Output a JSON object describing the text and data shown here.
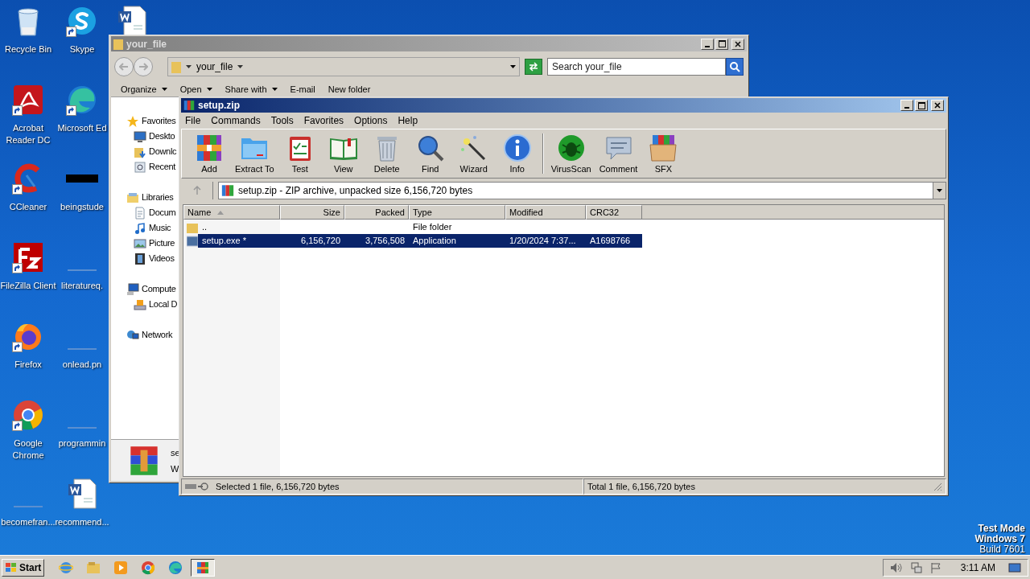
{
  "desktop": {
    "icons": [
      {
        "kind": "recycle",
        "label": "Recycle Bin",
        "shortcut": false
      },
      {
        "kind": "acrobat",
        "label": "Acrobat Reader DC",
        "shortcut": true
      },
      {
        "kind": "ccleaner",
        "label": "CCleaner",
        "shortcut": true
      },
      {
        "kind": "filezilla",
        "label": "FileZilla Client",
        "shortcut": true
      },
      {
        "kind": "firefox",
        "label": "Firefox",
        "shortcut": true
      },
      {
        "kind": "chrome",
        "label": "Google Chrome",
        "shortcut": true
      },
      {
        "kind": "line",
        "label": "becomefran...",
        "shortcut": false
      },
      {
        "kind": "skype",
        "label": "Skype",
        "shortcut": true
      },
      {
        "kind": "edge",
        "label": "Microsoft Ed",
        "shortcut": true
      },
      {
        "kind": "blackbox",
        "label": "beingstude",
        "shortcut": false
      },
      {
        "kind": "line",
        "label": "literatureq.",
        "shortcut": false
      },
      {
        "kind": "line",
        "label": "onlead.pn",
        "shortcut": false
      },
      {
        "kind": "line",
        "label": "programmin",
        "shortcut": false
      },
      {
        "kind": "word",
        "label": "recommend...",
        "shortcut": false
      },
      {
        "kind": "word",
        "shortcut": false
      }
    ],
    "os_notice": [
      {
        "text": "Test Mode",
        "bold": true
      },
      {
        "text": "Windows 7",
        "bold": true
      },
      {
        "text": "Build 7601",
        "bold": false
      }
    ]
  },
  "explorer": {
    "title": "your_file",
    "path": "your_file",
    "search": {
      "placeholder": "Search your_file"
    },
    "toolbar": [
      {
        "label": "Organize",
        "menu": true
      },
      {
        "label": "Open",
        "menu": true
      },
      {
        "label": "Share with",
        "menu": true
      },
      {
        "label": "E-mail",
        "menu": false
      },
      {
        "label": "New folder",
        "menu": false
      }
    ],
    "nav": [
      {
        "kind": "favorites",
        "label": "Favorites",
        "children": [
          {
            "kind": "desktop",
            "label": "Deskto"
          },
          {
            "kind": "downloads",
            "label": "Downlc"
          },
          {
            "kind": "recent",
            "label": "Recent"
          }
        ]
      },
      {
        "kind": "libraries",
        "label": "Libraries",
        "children": [
          {
            "kind": "documents",
            "label": "Docum"
          },
          {
            "kind": "music",
            "label": "Music"
          },
          {
            "kind": "pictures",
            "label": "Picture"
          },
          {
            "kind": "videos",
            "label": "Videos"
          }
        ]
      },
      {
        "kind": "computer",
        "label": "Compute",
        "children": [
          {
            "kind": "drive",
            "label": "Local D"
          }
        ]
      },
      {
        "kind": "network",
        "label": "Network"
      }
    ],
    "details": [
      "se",
      "W"
    ]
  },
  "winrar": {
    "title": "setup.zip",
    "menu": [
      "File",
      "Commands",
      "Tools",
      "Favorites",
      "Options",
      "Help"
    ],
    "tools": [
      {
        "kind": "add",
        "label": "Add"
      },
      {
        "kind": "extract",
        "label": "Extract To"
      },
      {
        "kind": "test",
        "label": "Test"
      },
      {
        "kind": "view",
        "label": "View"
      },
      {
        "kind": "delete",
        "label": "Delete"
      },
      {
        "kind": "find",
        "label": "Find"
      },
      {
        "kind": "wizard",
        "label": "Wizard"
      },
      {
        "kind": "info",
        "label": "Info"
      },
      {
        "kind": "virusscan",
        "label": "VirusScan"
      },
      {
        "kind": "comment",
        "label": "Comment"
      },
      {
        "kind": "sfx",
        "label": "SFX"
      }
    ],
    "address": "setup.zip - ZIP archive, unpacked size 6,156,720 bytes",
    "columns": [
      {
        "label": "Name",
        "sorted": true
      },
      {
        "label": "Size",
        "sorted": false
      },
      {
        "label": "Packed",
        "sorted": false
      },
      {
        "label": "Type",
        "sorted": false
      },
      {
        "label": "Modified",
        "sorted": false
      },
      {
        "label": "CRC32",
        "sorted": false
      }
    ],
    "rows": [
      {
        "kind": "folder",
        "selected": false,
        "cells": [
          "..",
          null,
          null,
          "File folder",
          null,
          null
        ]
      },
      {
        "kind": "exe",
        "selected": true,
        "cells": [
          "setup.exe *",
          "6,156,720",
          "3,756,508",
          "Application",
          "1/20/2024 7:37...",
          "A1698766"
        ]
      }
    ],
    "status": [
      "Selected 1 file, 6,156,720 bytes",
      "Total 1 file, 6,156,720 bytes"
    ]
  },
  "taskbar": {
    "start": "Start",
    "apps": [
      {
        "kind": "ie",
        "active": false
      },
      {
        "kind": "explorer",
        "active": false
      },
      {
        "kind": "media",
        "active": false
      },
      {
        "kind": "chrome",
        "active": false
      },
      {
        "kind": "edge",
        "active": false
      },
      {
        "kind": "winrar",
        "active": true
      }
    ],
    "clock": "3:11 AM"
  }
}
